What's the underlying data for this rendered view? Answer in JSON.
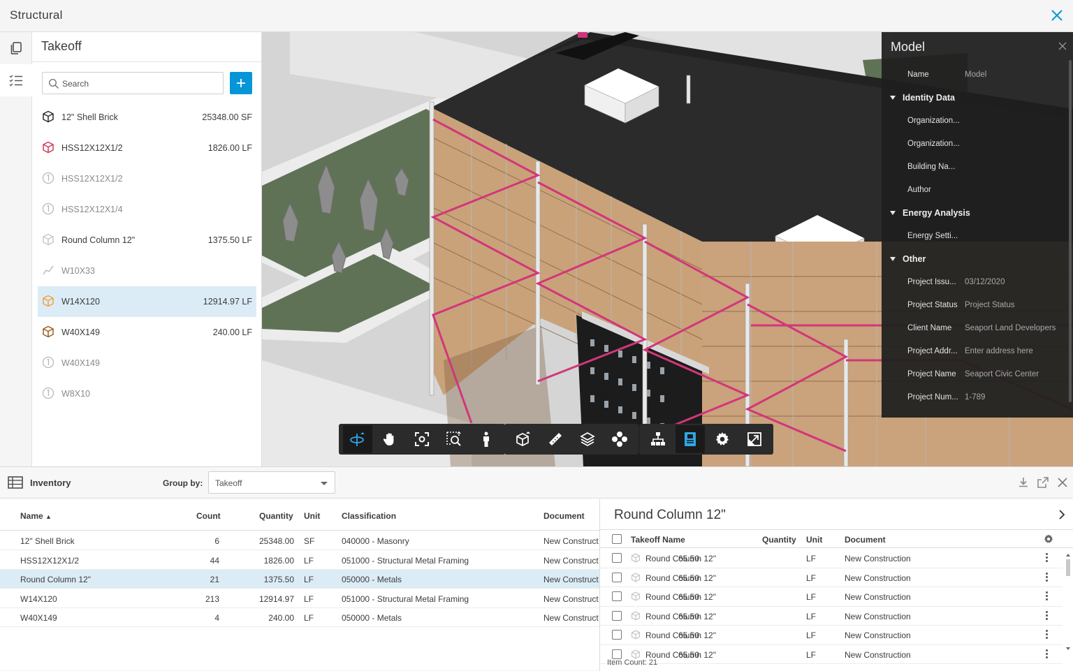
{
  "app": {
    "title": "Structural"
  },
  "takeoff": {
    "title": "Takeoff",
    "search_placeholder": "Search",
    "items": [
      {
        "name": "12\" Shell Brick",
        "qty": "25348.00 SF",
        "icon": "cube-icon",
        "color": "#2b2b2b",
        "dim": false
      },
      {
        "name": "HSS12X12X1/2",
        "qty": "1826.00 LF",
        "icon": "cube-icon",
        "color": "#d2365b",
        "dim": false
      },
      {
        "name": "HSS12X12X1/2",
        "qty": "",
        "icon": "count-icon",
        "color": "#b8b8b8",
        "dim": true
      },
      {
        "name": "HSS12X12X1/4",
        "qty": "",
        "icon": "count-icon",
        "color": "#b8b8b8",
        "dim": true
      },
      {
        "name": "Round Column 12\"",
        "qty": "1375.50 LF",
        "icon": "cube-icon",
        "color": "#c8c8c8",
        "dim": false
      },
      {
        "name": "W10X33",
        "qty": "",
        "icon": "line-icon",
        "color": "#b8b8b8",
        "dim": true
      },
      {
        "name": "W14X120",
        "qty": "12914.97 LF",
        "icon": "cube-icon",
        "color": "#f0a03c",
        "dim": false,
        "selected": true
      },
      {
        "name": "W40X149",
        "qty": "240.00 LF",
        "icon": "cube-icon",
        "color": "#9c5a20",
        "dim": false
      },
      {
        "name": "W40X149",
        "qty": "",
        "icon": "count-icon",
        "color": "#b8b8b8",
        "dim": true
      },
      {
        "name": "W8X10",
        "qty": "",
        "icon": "count-icon",
        "color": "#b8b8b8",
        "dim": true
      }
    ]
  },
  "model": {
    "title": "Model",
    "name_key": "Name",
    "name_val": "Model",
    "cat_identity": "Identity Data",
    "identity": [
      "Organization...",
      "Organization...",
      "Building Na...",
      "Author"
    ],
    "cat_energy": "Energy Analysis",
    "energy": [
      "Energy Setti..."
    ],
    "cat_other": "Other",
    "other": [
      {
        "k": "Project Issu...",
        "v": "03/12/2020"
      },
      {
        "k": "Project Status",
        "v": "Project Status"
      },
      {
        "k": "Client Name",
        "v": "Seaport Land Developers"
      },
      {
        "k": "Project Addr...",
        "v": "Enter address here"
      },
      {
        "k": "Project Name",
        "v": "Seaport Civic Center"
      },
      {
        "k": "Project Num...",
        "v": "1-789"
      }
    ]
  },
  "inventory": {
    "title": "Inventory",
    "group_by_label": "Group by:",
    "group_by_value": "Takeoff",
    "columns": {
      "name": "Name",
      "count": "Count",
      "quantity": "Quantity",
      "unit": "Unit",
      "classification": "Classification",
      "document": "Document"
    },
    "rows": [
      {
        "name": "12\" Shell Brick",
        "count": "6",
        "quantity": "25348.00",
        "unit": "SF",
        "classification": "040000 - Masonry",
        "document": "New Construct"
      },
      {
        "name": "HSS12X12X1/2",
        "count": "44",
        "quantity": "1826.00",
        "unit": "LF",
        "classification": "051000 - Structural Metal Framing",
        "document": "New Construct"
      },
      {
        "name": "Round Column 12\"",
        "count": "21",
        "quantity": "1375.50",
        "unit": "LF",
        "classification": "050000 - Metals",
        "document": "New Construct",
        "selected": true
      },
      {
        "name": "W14X120",
        "count": "213",
        "quantity": "12914.97",
        "unit": "LF",
        "classification": "051000 - Structural Metal Framing",
        "document": "New Construct"
      },
      {
        "name": "W40X149",
        "count": "4",
        "quantity": "240.00",
        "unit": "LF",
        "classification": "050000 - Metals",
        "document": "New Construct"
      }
    ]
  },
  "detail": {
    "title": "Round Column 12\"",
    "columns": {
      "takeoff_name": "Takeoff Name",
      "quantity": "Quantity",
      "unit": "Unit",
      "document": "Document"
    },
    "rows": [
      {
        "name": "Round Column 12\"",
        "quantity": "65.50",
        "unit": "LF",
        "document": "New Construction"
      },
      {
        "name": "Round Column 12\"",
        "quantity": "65.50",
        "unit": "LF",
        "document": "New Construction"
      },
      {
        "name": "Round Column 12\"",
        "quantity": "65.50",
        "unit": "LF",
        "document": "New Construction"
      },
      {
        "name": "Round Column 12\"",
        "quantity": "65.50",
        "unit": "LF",
        "document": "New Construction"
      },
      {
        "name": "Round Column 12\"",
        "quantity": "65.50",
        "unit": "LF",
        "document": "New Construction"
      },
      {
        "name": "Round Column 12\"",
        "quantity": "65.50",
        "unit": "LF",
        "document": "New Construction"
      }
    ],
    "item_count": "Item Count: 21"
  },
  "colors": {
    "accent": "#0696d7",
    "selection": "#dcecf7",
    "brace": "#d2367a"
  }
}
